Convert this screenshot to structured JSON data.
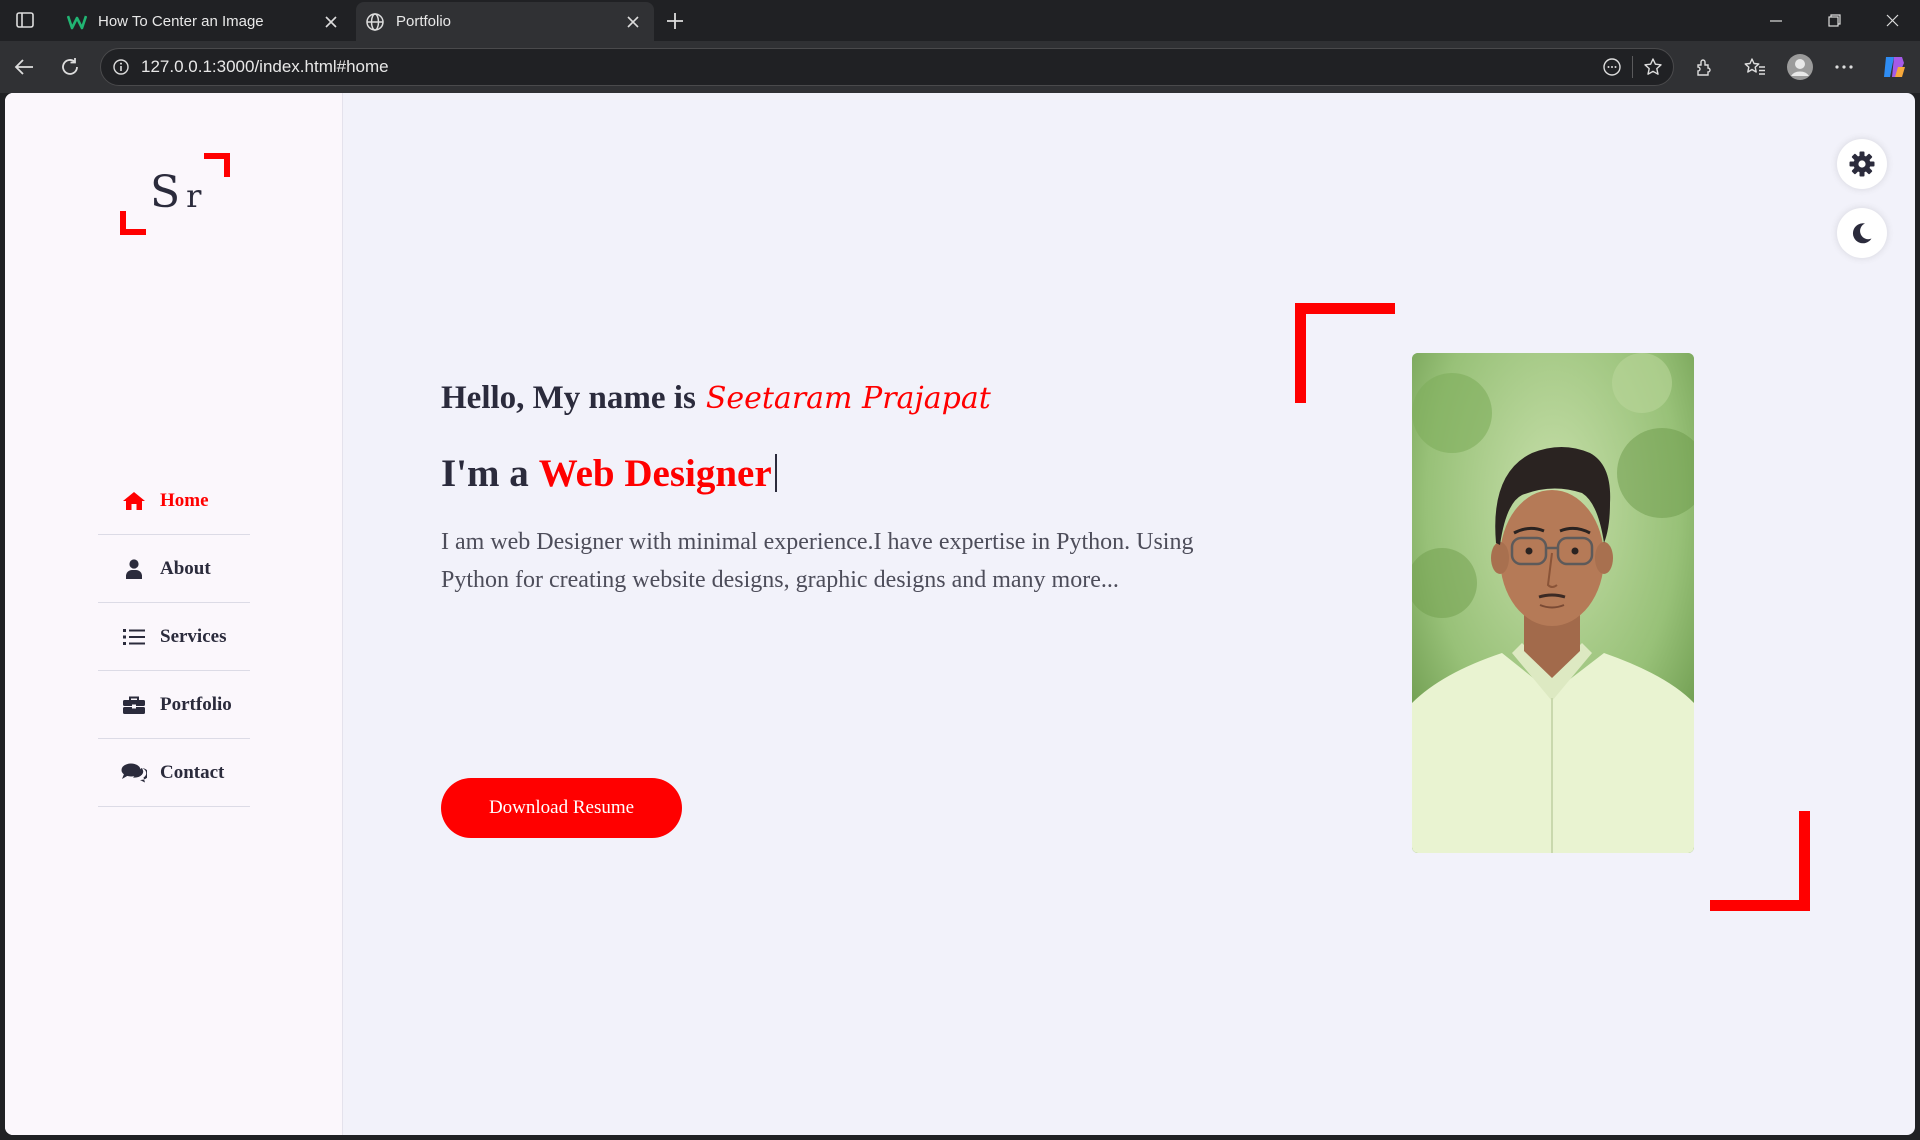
{
  "browser": {
    "tabs": [
      {
        "label": "How To Center an Image",
        "favicon": "w-logo-icon"
      },
      {
        "label": "Portfolio",
        "favicon": "globe-icon",
        "active": true
      }
    ],
    "url": "127.0.0.1:3000/index.html#home"
  },
  "logo": {
    "letter1": "S",
    "letter2": "r"
  },
  "nav": {
    "items": [
      {
        "label": "Home",
        "icon": "home-icon",
        "active": true
      },
      {
        "label": "About",
        "icon": "user-icon"
      },
      {
        "label": "Services",
        "icon": "list-icon"
      },
      {
        "label": "Portfolio",
        "icon": "briefcase-icon"
      },
      {
        "label": "Contact",
        "icon": "comments-icon"
      }
    ]
  },
  "hero": {
    "greeting": "Hello, My name is",
    "name": "Seetaram Prajapat",
    "im_prefix": "I'm a",
    "role": "Web Designer",
    "description": "I am web Designer with minimal experience.I have expertise in Python. Using Python for creating website designs, graphic designs and many more...",
    "button": "Download Resume"
  },
  "colors": {
    "accent": "#ff0000",
    "text": "#2b2b3c",
    "background": "#f2f2fa",
    "sidebar": "#fbf7fc"
  }
}
